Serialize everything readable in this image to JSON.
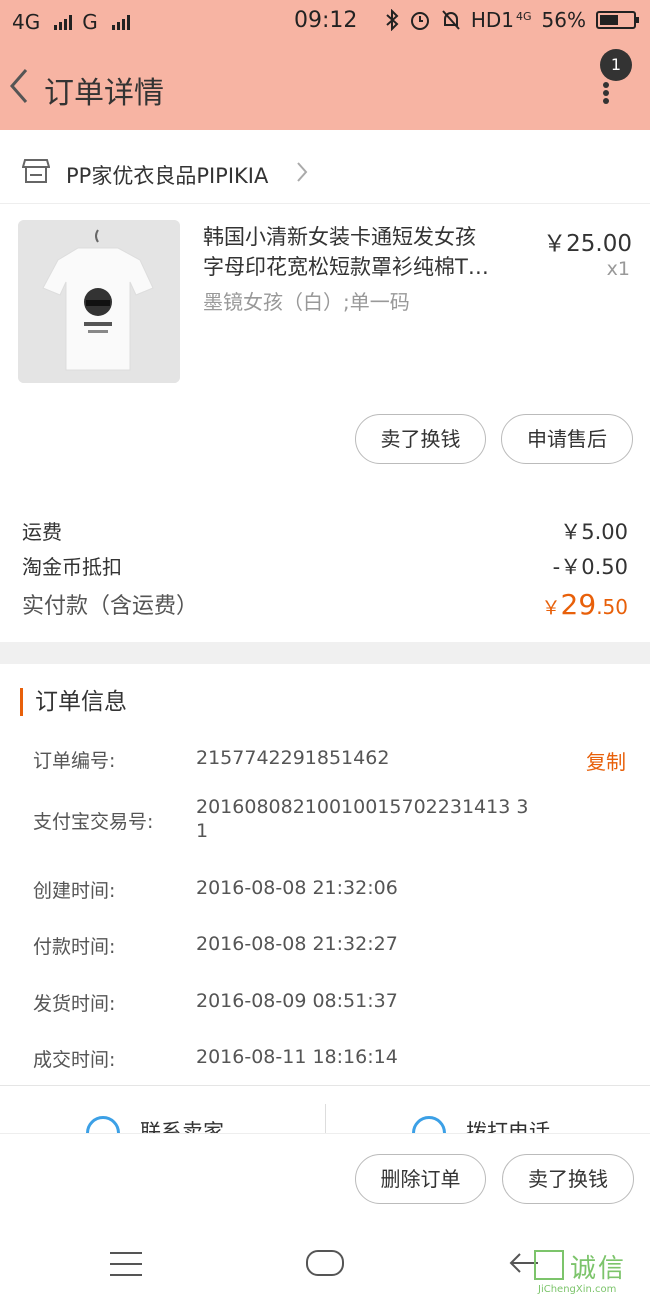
{
  "status": {
    "left_network1": "4G",
    "left_network2": "G",
    "time": "09:12",
    "hd": "HD1",
    "net4g": "4G",
    "battery": "56%",
    "battery_level": 0.56
  },
  "header": {
    "title": "订单详情",
    "badge": "1"
  },
  "shop": {
    "name": "PP家优衣良品PIPIKIA"
  },
  "product": {
    "title_line1": "韩国小清新女装卡通短发女孩",
    "title_line2": "字母印花宽松短款罩衫纯棉T…",
    "sku": "墨镜女孩（白）;单一码",
    "price": "￥25.00",
    "qty": "x1",
    "btn_sell": "卖了换钱",
    "btn_aftersale": "申请售后"
  },
  "fees": {
    "shipping_label": "运费",
    "shipping_value": "￥5.00",
    "coin_label": "淘金币抵扣",
    "coin_value": "-￥0.50",
    "paid_label": "实付款（含运费）",
    "paid_currency": "￥",
    "paid_int": "29",
    "paid_dec": ".50"
  },
  "order_info": {
    "title": "订单信息",
    "copy": "复制",
    "rows": [
      {
        "label": "订单编号:",
        "value": "2157742291851462"
      },
      {
        "label": "支付宝交易号:",
        "value": "20160808210010015702231413 31"
      },
      {
        "label": "创建时间:",
        "value": "2016-08-08 21:32:06"
      },
      {
        "label": "付款时间:",
        "value": "2016-08-08 21:32:27"
      },
      {
        "label": "发货时间:",
        "value": "2016-08-09 08:51:37"
      },
      {
        "label": "成交时间:",
        "value": "2016-08-11 18:16:14"
      }
    ]
  },
  "contact": {
    "seller": "联系卖家",
    "call": "拨打电话"
  },
  "bottom": {
    "delete": "删除订单",
    "sell": "卖了换钱"
  },
  "watermark": {
    "text": "诚信",
    "sub": "JiChengXin.com"
  }
}
